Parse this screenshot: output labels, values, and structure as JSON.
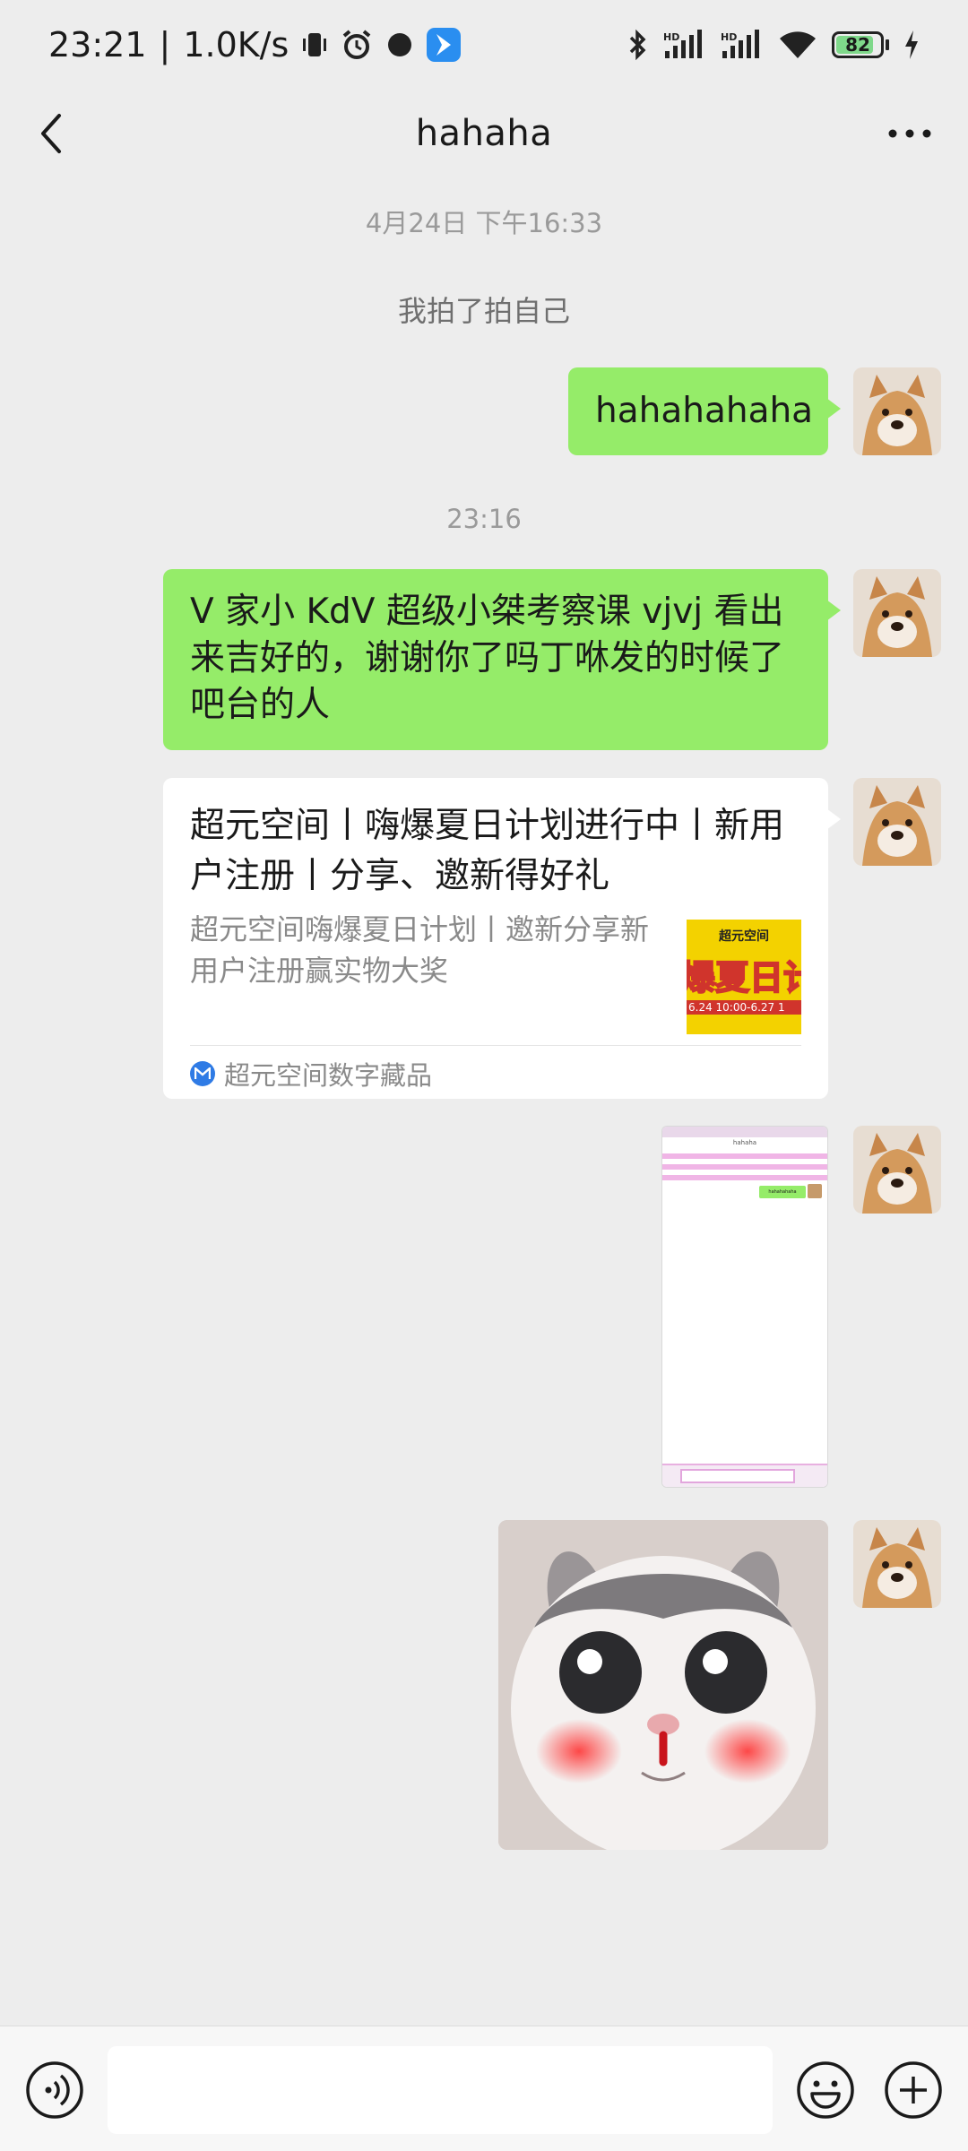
{
  "status_bar": {
    "time": "23:21",
    "separator": "|",
    "net_speed": "1.0K/s",
    "battery": "82",
    "icons": [
      "vibrate-icon",
      "alarm-icon",
      "dot-icon",
      "app-badge-icon",
      "bluetooth-icon",
      "signal-hd-icon",
      "signal-hd-icon",
      "wifi-icon",
      "battery-icon",
      "charging-icon"
    ]
  },
  "header": {
    "title": "hahaha",
    "back_icon": "chevron-left-icon",
    "more_icon": "more-dots-icon"
  },
  "messages": {
    "timestamp_1": "4月24日 下午16:33",
    "system_1": "我拍了拍自己",
    "text_1": "hahahahaha",
    "timestamp_2": "23:16",
    "text_2": "V 家小 KdV 超级小桀考察课 vjvj 看出来吉好的，谢谢你了吗丁咻发的时候了吧台的人",
    "card": {
      "title": "超元空间丨嗨爆夏日计划进行中丨新用户注册丨分享、邀新得好礼",
      "description": "超元空间嗨爆夏日计划丨邀新分享新用户注册赢实物大奖",
      "thumb_brand": "超元空间",
      "thumb_big": "爆夏日计",
      "thumb_date": "6.24 10:00-6.27 1",
      "source": "超元空间数字藏品"
    },
    "screenshot_thumb": {
      "title": "hahaha",
      "bubble": "hahahahaha"
    }
  },
  "input_bar": {
    "value": "",
    "placeholder": ""
  },
  "colors": {
    "background": "#ededed",
    "bubble_green": "#95ec69",
    "card_white": "#ffffff",
    "text_gray": "#9a9a9a"
  }
}
